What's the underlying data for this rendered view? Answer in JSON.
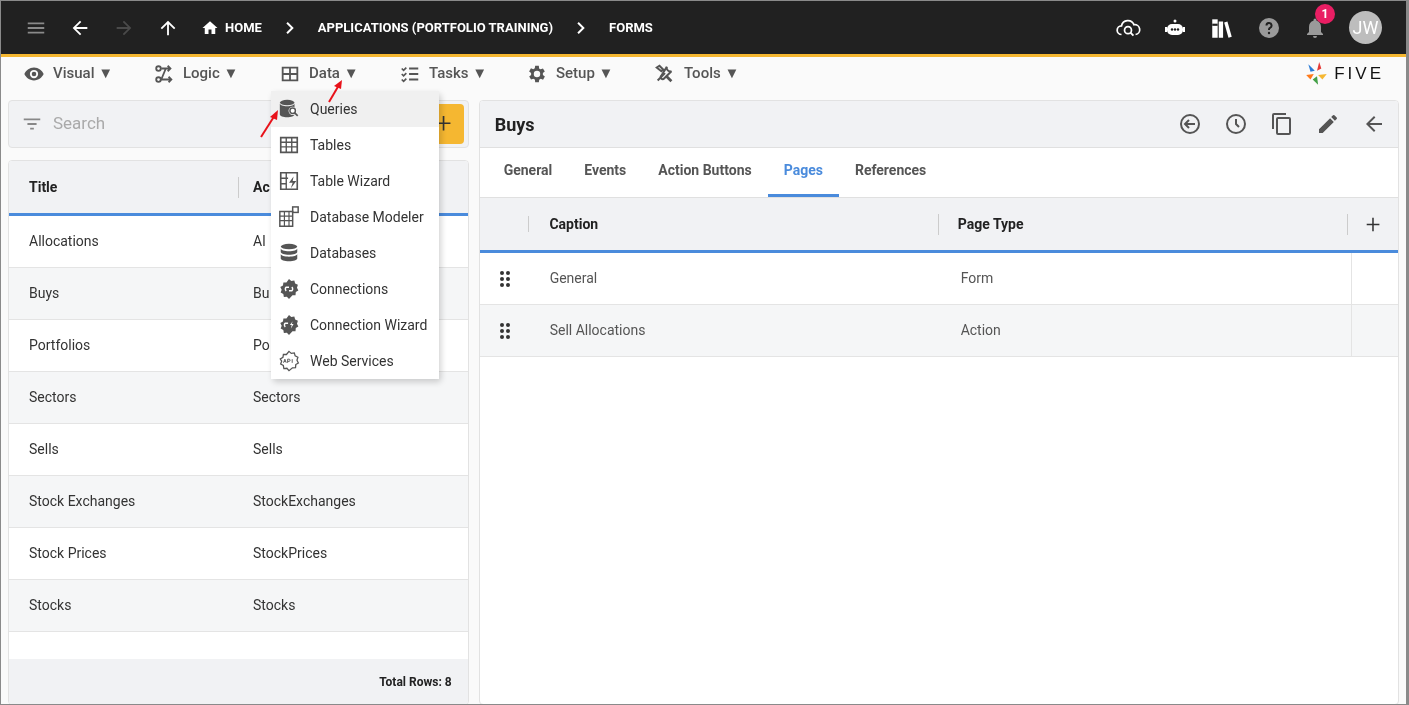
{
  "top_bar": {
    "nav_buttons": [
      {
        "kind": "back",
        "disabled": false
      },
      {
        "kind": "forward",
        "disabled": true
      },
      {
        "kind": "up",
        "disabled": false
      }
    ],
    "breadcrumbs": [
      "HOME",
      "APPLICATIONS (PORTFOLIO TRAINING)",
      "FORMS"
    ],
    "notification_count": "1",
    "avatar": "JW"
  },
  "menu": [
    {
      "label": "Visual",
      "caret": "▼",
      "kind": "eye"
    },
    {
      "label": "Logic",
      "caret": "▼",
      "kind": "logic"
    },
    {
      "label": "Data",
      "caret": "▼",
      "kind": "data"
    },
    {
      "label": "Tasks",
      "caret": "▼",
      "kind": "tasks"
    },
    {
      "label": "Setup",
      "caret": "▼",
      "kind": "gear"
    },
    {
      "label": "Tools",
      "caret": "▼",
      "kind": "tools"
    }
  ],
  "logo": "FIVE",
  "left_panel": {
    "search": {
      "placeholder": "Search"
    },
    "add_button": "+",
    "columns": [
      "Title",
      "Ac"
    ],
    "rows": [
      [
        "Allocations",
        "Al"
      ],
      [
        "Buys",
        "Bu"
      ],
      [
        "Portfolios",
        "Po"
      ],
      [
        "Sectors",
        "Sectors"
      ],
      [
        "Sells",
        "Sells"
      ],
      [
        "Stock Exchanges",
        "StockExchanges"
      ],
      [
        "Stock Prices",
        "StockPrices"
      ],
      [
        "Stocks",
        "Stocks"
      ]
    ],
    "footer": "Total Rows: 8"
  },
  "dropdown": [
    {
      "label": "Queries",
      "kind": "queries",
      "selected": true
    },
    {
      "label": "Tables",
      "kind": "tables",
      "selected": false
    },
    {
      "label": "Table Wizard",
      "kind": "wizard",
      "selected": false
    },
    {
      "label": "Database Modeler",
      "kind": "modeler",
      "selected": false
    },
    {
      "label": "Databases",
      "kind": "databases",
      "selected": false
    },
    {
      "label": "Connections",
      "kind": "connections",
      "selected": false
    },
    {
      "label": "Connection Wizard",
      "kind": "connwizard",
      "selected": false
    },
    {
      "label": "Web Services",
      "kind": "webservices",
      "selected": false
    }
  ],
  "form": {
    "title": "Buys",
    "tabs": [
      {
        "label": "General",
        "selected": false
      },
      {
        "label": "Events",
        "selected": false
      },
      {
        "label": "Action Buttons",
        "selected": false
      },
      {
        "label": "Pages",
        "selected": true
      },
      {
        "label": "References",
        "selected": false
      }
    ],
    "columns": [
      "Caption",
      "Page Type"
    ],
    "add_button": "+",
    "rows": [
      [
        "General",
        "Form"
      ],
      [
        "Sell Allocations",
        "Action"
      ]
    ]
  }
}
